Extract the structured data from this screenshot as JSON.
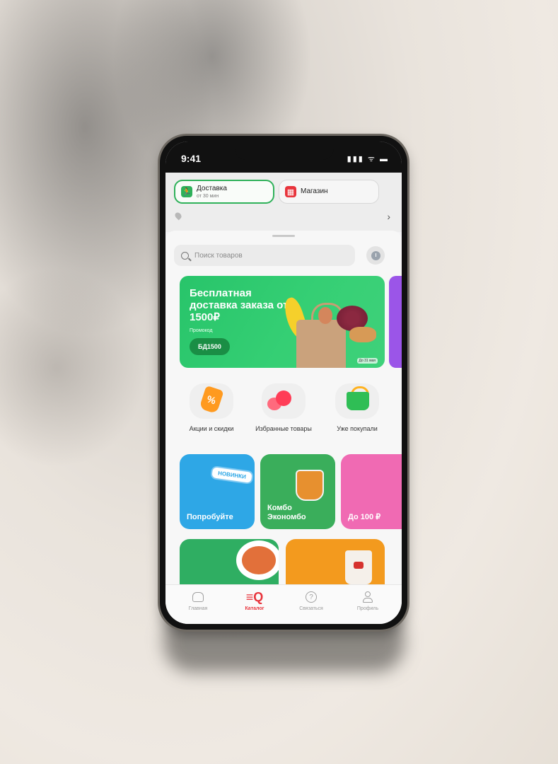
{
  "status_bar": {
    "time": "9:41",
    "icons": "▮▮▮ ᯤ ▬"
  },
  "header": {
    "delivery": {
      "title": "Доставка",
      "subtitle": "от 30 мин"
    },
    "store": {
      "title": "Магазин"
    },
    "address_chevron": "›"
  },
  "search": {
    "placeholder": "Поиск товаров"
  },
  "banner": {
    "title": "Бесплатная доставка заказа от 1500₽",
    "promo_label": "Промокод",
    "promo_code": "БД1500",
    "until": "До 31 мая"
  },
  "quick_links": [
    {
      "label": "Акции и скидки",
      "icon": "discount-tag-icon"
    },
    {
      "label": "Избранные товары",
      "icon": "hearts-icon"
    },
    {
      "label": "Уже покупали",
      "icon": "basket-icon"
    }
  ],
  "cards": [
    {
      "label": "Попробуйте",
      "badge": "НОВИНКИ",
      "color": "#2ea7e6"
    },
    {
      "label": "Комбо Экономбо",
      "color": "#3aae5b"
    },
    {
      "label": "До 100 ₽",
      "color": "#f06ab3"
    }
  ],
  "cards_row2": [
    {
      "color": "#2fae62"
    },
    {
      "color": "#f39a1e"
    }
  ],
  "tabs": [
    {
      "label": "Главная",
      "icon": "home-icon"
    },
    {
      "label": "Каталог",
      "icon": "catalog-search-icon",
      "active": true
    },
    {
      "label": "Связаться",
      "icon": "help-icon"
    },
    {
      "label": "Профиль",
      "icon": "profile-icon"
    }
  ],
  "colors": {
    "accent_red": "#e8333b",
    "accent_green": "#2fb15a"
  }
}
